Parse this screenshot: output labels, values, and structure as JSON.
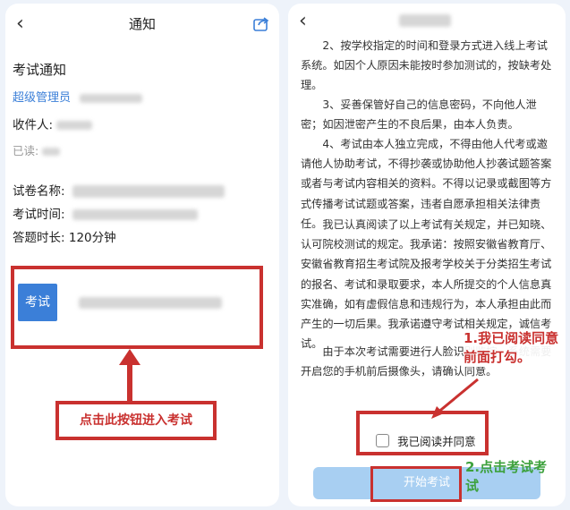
{
  "left": {
    "header_title": "通知",
    "notice_title": "考试通知",
    "sender": "超级管理员",
    "recipient_label": "收件人:",
    "read_label": "已读:",
    "paper_name_label": "试卷名称:",
    "exam_time_label": "考试时间:",
    "duration_label": "答题时长:",
    "duration_value": "120分钟",
    "exam_button_label": "考试",
    "instruction": "点击此按钮进入考试"
  },
  "right": {
    "paragraphs": [
      "2、按学校指定的时间和登录方式进入线上考试系统。如因个人原因未能按时参加测试的，按缺考处理。",
      "3、妥善保管好自己的信息密码，不向他人泄密；如因泄密产生的不良后果，由本人负责。",
      "4、考试由本人独立完成，不得由他人代考或邀请他人协助考试，不得抄袭或协助他人抄袭试题答案或者与考试内容相关的资料。不得以记录或截图等方式传播考试试题或答案，违者自愿承担相关法律责任。",
      "我已认真阅读了以上考试有关规定，并已知晓、认可院校测试的规定。我承诺：按照安徽省教育厅、安徽省教育招生考试院及报考学校关于分类招生考试的报名、考试和录取要求，本人所提交的个人信息真实准确，如有虚假信息和违规行为，本人承担由此而产生的一切后果。我承诺遵守考试相关规定，诚信考试。",
      "由于本次考试需要进行人脸识别监控，系统需要开启您的手机前后摄像头，请确认同意。"
    ],
    "agree_label": "我已阅读并同意",
    "start_button_label": "开始考试",
    "annotation_1": "1.我已阅读同意前面打勾。",
    "annotation_2": "2.点击考试考试"
  },
  "colors": {
    "red": "#c9312f",
    "blue": "#3b7fd8",
    "green": "#3da13d",
    "button_light": "#a8cff2"
  }
}
